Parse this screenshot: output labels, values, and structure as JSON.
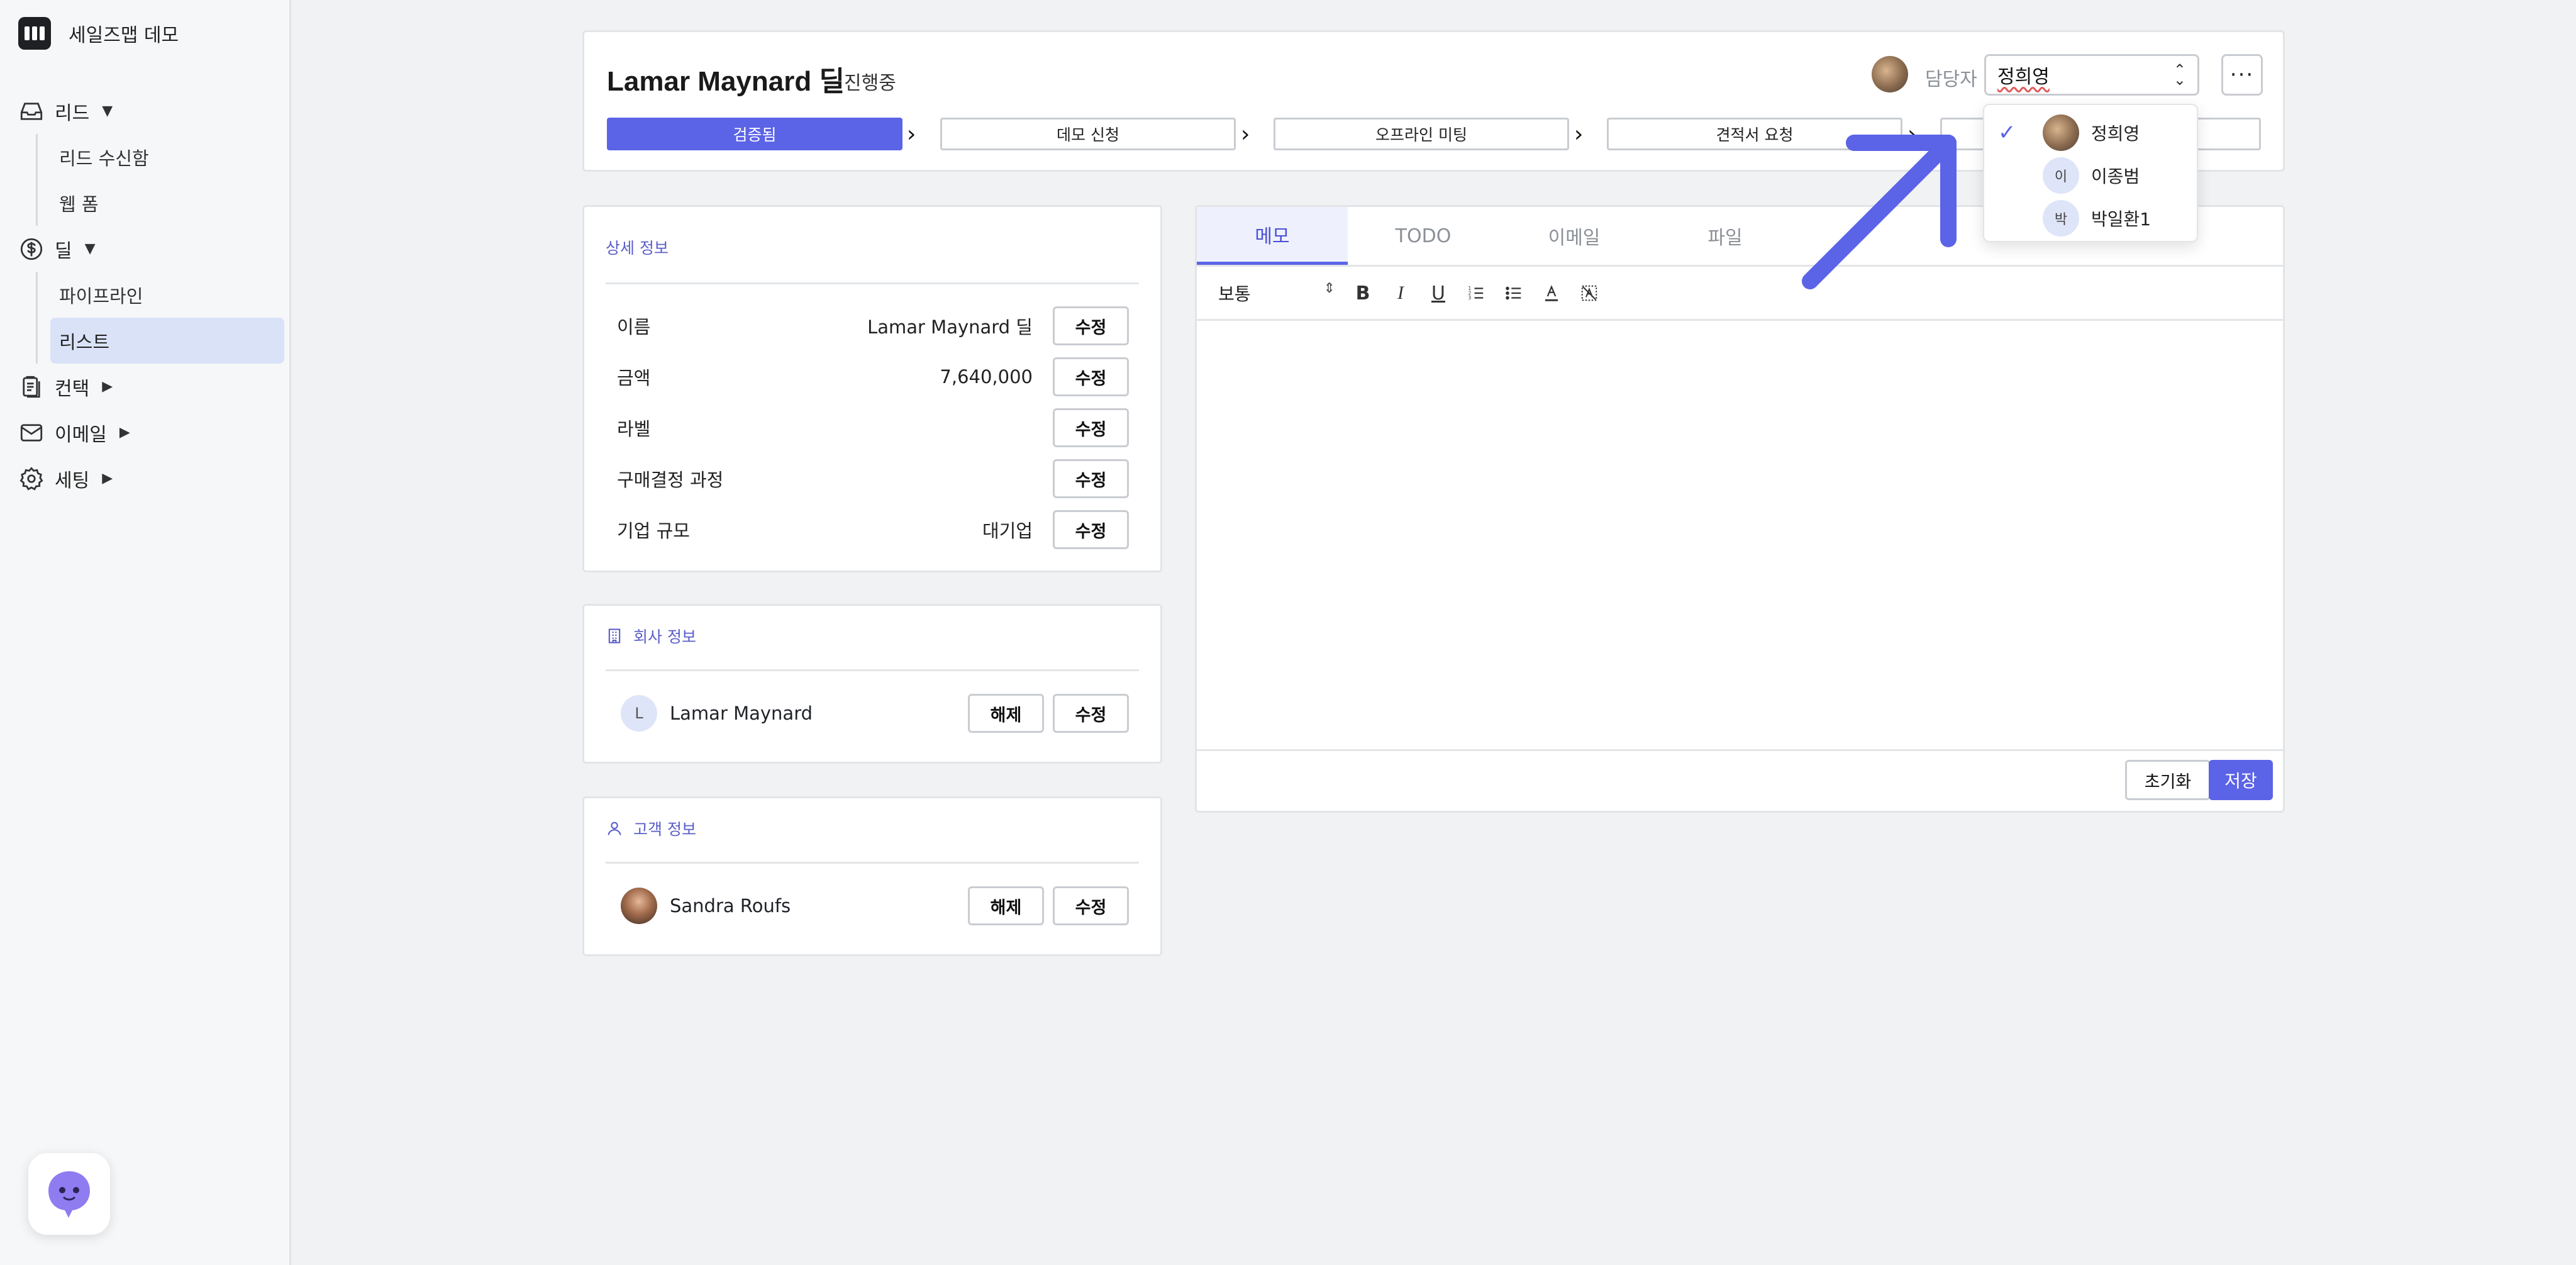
{
  "app": {
    "name": "세일즈맵 데모"
  },
  "sidebar": {
    "items": [
      {
        "label": "리드",
        "icon": "inbox-icon",
        "caret": "▼",
        "children": [
          "리드 수신함",
          "웹 폼"
        ]
      },
      {
        "label": "딜",
        "icon": "dollar-icon",
        "caret": "▼",
        "children": [
          "파이프라인",
          "리스트"
        ]
      },
      {
        "label": "컨택",
        "icon": "clipboard-icon",
        "caret": "▶"
      },
      {
        "label": "이메일",
        "icon": "mail-icon",
        "caret": "▶"
      },
      {
        "label": "세팅",
        "icon": "gear-icon",
        "caret": "▶"
      }
    ],
    "active_item": "리스트"
  },
  "header": {
    "title": "Lamar Maynard 딜",
    "status": "진행중",
    "owner_label": "담당자",
    "owner_value": "정희영",
    "more": "···",
    "stages": [
      "검증됨",
      "데모 신청",
      "오프라인 미팅",
      "견적서 요청"
    ],
    "active_stage": "검증됨"
  },
  "owner_dropdown": {
    "options": [
      {
        "name": "정희영",
        "initial": "",
        "selected": true
      },
      {
        "name": "이종범",
        "initial": "이",
        "selected": false
      },
      {
        "name": "박일환1",
        "initial": "박",
        "selected": false
      }
    ]
  },
  "details": {
    "title": "상세 정보",
    "edit_label": "수정",
    "rows": [
      {
        "label": "이름",
        "value": "Lamar Maynard 딜"
      },
      {
        "label": "금액",
        "value": "7,640,000"
      },
      {
        "label": "라벨",
        "value": ""
      },
      {
        "label": "구매결정 과정",
        "value": ""
      },
      {
        "label": "기업 규모",
        "value": "대기업"
      }
    ]
  },
  "company": {
    "title": "회사 정보",
    "initial": "L",
    "name": "Lamar Maynard",
    "unlink_label": "해제",
    "edit_label": "수정"
  },
  "customer": {
    "title": "고객 정보",
    "name": "Sandra Roufs",
    "unlink_label": "해제",
    "edit_label": "수정"
  },
  "memo": {
    "tabs": [
      "메모",
      "TODO",
      "이메일",
      "파일"
    ],
    "active_tab": "메모",
    "text_style": "보통",
    "toolbar_icons": [
      "bold-icon",
      "italic-icon",
      "underline-icon",
      "ordered-list-icon",
      "bullet-list-icon",
      "text-color-icon",
      "clear-format-icon"
    ],
    "reset_label": "초기화",
    "save_label": "저장"
  },
  "colors": {
    "accent": "#5b63e6",
    "active_nav_bg": "#d9e2f7",
    "annotation_arrow": "#5b63e6"
  }
}
